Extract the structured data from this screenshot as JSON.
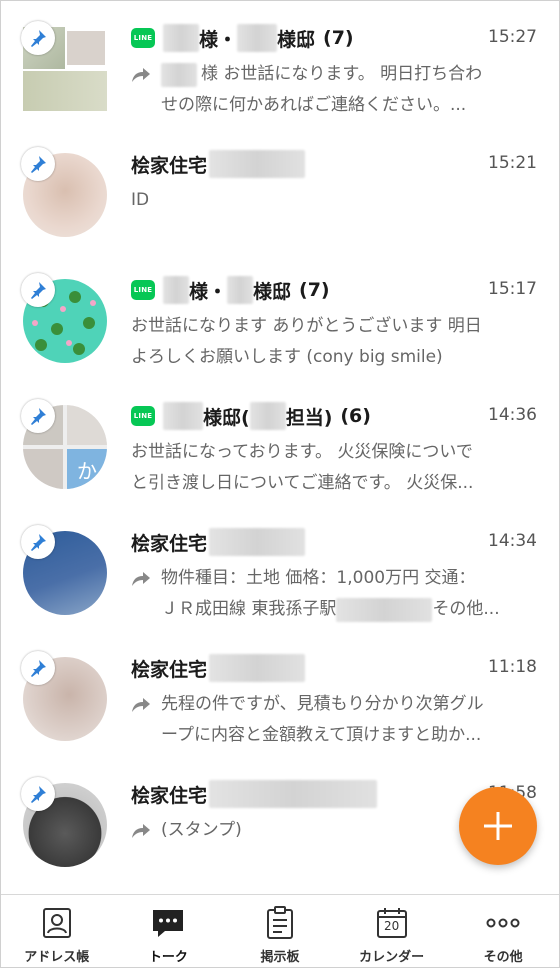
{
  "conversations": [
    {
      "title_a": "様・",
      "title_b": "様邸",
      "count": "(7)",
      "time": "15:27",
      "line1": "様 お世話になります。 明日打ち合わ",
      "line2": "せの際に何かあればご連絡ください。..."
    },
    {
      "title": "桧家住宅",
      "time": "15:21",
      "line1": "ID"
    },
    {
      "title_a": "様・",
      "title_b": "様邸",
      "count": "(7)",
      "time": "15:17",
      "line1": "お世話になります ありがとうございます 明日",
      "line2": "よろしくお願いします (cony big smile)"
    },
    {
      "title_a": "様邸(",
      "title_b": "担当)",
      "count": "(6)",
      "time": "14:36",
      "line1": "お世話になっております。 火災保険についで",
      "line2": "と引き渡し日についてご連絡です。 火災保..."
    },
    {
      "title": "桧家住宅",
      "time": "14:34",
      "line1": "物件種目：土地 価格：1,000万円 交通：",
      "line2a": "ＪＲ成田線 東我孫子駅",
      "line2b": "その他..."
    },
    {
      "title": "桧家住宅",
      "time": "11:18",
      "line1": "先程の件ですが、見積もり分かり次第グル",
      "line2": "ープに内容と金額教えて頂けますと助か..."
    },
    {
      "title": "桧家住宅",
      "time": "11:58",
      "line1": "(スタンプ)"
    }
  ],
  "line_badge": "LINE",
  "avatar_text": "か",
  "tabs": [
    "アドレス帳",
    "トーク",
    "掲示板",
    "カレンダー",
    "その他"
  ],
  "calendar_day": "20",
  "icons": {
    "pin": "pin-icon",
    "forward": "forward-arrow-icon",
    "add": "plus-icon",
    "address": "address-book-icon",
    "talk": "talk-bubble-icon",
    "board": "bulletin-board-icon",
    "calendar": "calendar-icon",
    "more": "more-dots-icon"
  },
  "colors": {
    "accent": "#f58220",
    "line_green": "#06c755",
    "pin": "#2f7fd6"
  }
}
